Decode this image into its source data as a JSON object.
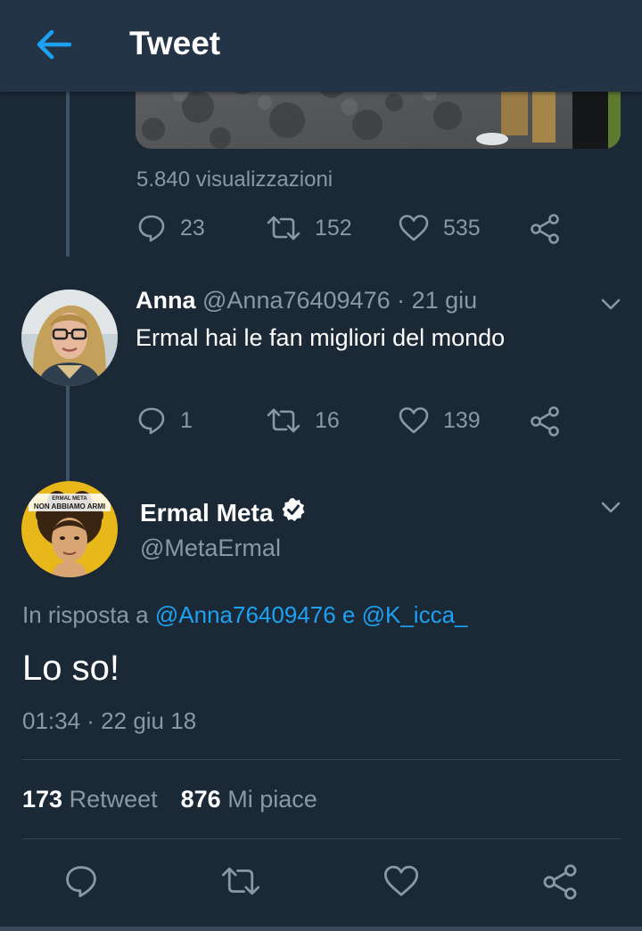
{
  "header": {
    "title": "Tweet",
    "back_icon": "arrow-left-icon"
  },
  "colors": {
    "background": "#1b2836",
    "header": "#243447",
    "accent": "#1da1f2",
    "secondary_text": "#8899a6",
    "divider": "#38444d"
  },
  "previous_tweet": {
    "views": "5.840 visualizzazioni",
    "replies": "23",
    "retweets": "152",
    "likes": "535"
  },
  "reply_tweet": {
    "name": "Anna",
    "handle": "@Anna76409476",
    "date": "· 21 giu",
    "text": "Ermal hai le fan migliori del mondo",
    "replies": "1",
    "retweets": "16",
    "likes": "139"
  },
  "main_tweet": {
    "name": "Ermal Meta",
    "handle": "@MetaErmal",
    "verified": true,
    "in_reply_prefix": "In risposta a",
    "mention_1": "@Anna76409476",
    "conjunction": "e",
    "mention_2": "@K_icca_",
    "text": "Lo so!",
    "timestamp": "01:34 · 22 giu 18",
    "retweet_count": "173",
    "retweet_label": "Retweet",
    "like_count": "876",
    "like_label": "Mi piace",
    "avatar_caption_top": "ERMAL META",
    "avatar_caption_bottom": "NON ABBIAMO ARMI"
  }
}
